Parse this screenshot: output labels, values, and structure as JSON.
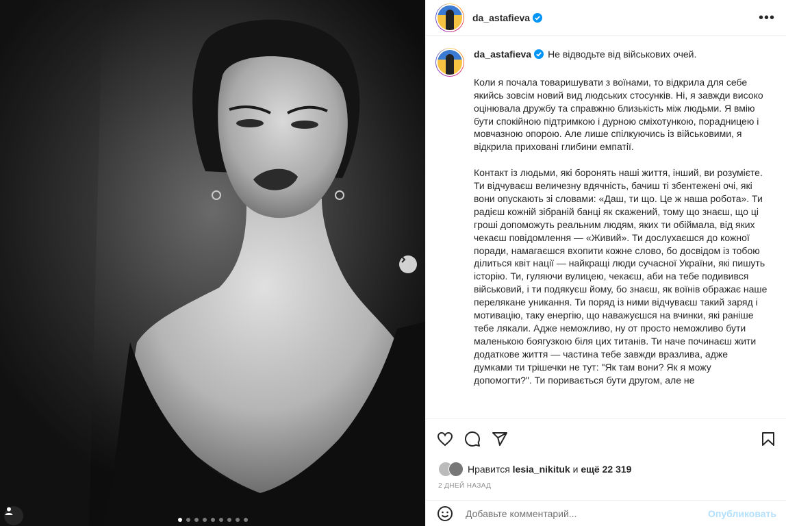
{
  "post": {
    "username": "da_astafieva",
    "verified": true,
    "more_label": "•••"
  },
  "caption": {
    "username": "da_astafieva",
    "first_line": "Не відводьте від військових очей.",
    "text": "Коли я почала товаришувати з воїнами, то відкрила для себе якийсь зовсім новий вид людських стосунків. Ні, я завжди високо оцінювала дружбу та справжню близькість між людьми. Я вмію бути спокійною підтримкою і дурною сміхотункою, порадницею і мовчазною опорою. Але лише спілкуючись із військовими, я відкрила приховані глибини емпатії.\n\nКонтакт із людьми, які боронять наші життя, інший, ви розумієте. Ти відчуваєш величезну вдячність, бачиш ті збентежені очі, які вони опускають зі словами: «Даш, ти що. Це ж наша робота». Ти радієш кожній зібраній банці як скажений, тому що знаєш, що ці гроші допоможуть реальним людям, яких ти обіймала, від яких чекаєш повідомлення — «Живий». Ти дослухаєшся до кожної поради, намагаєшся вхопити кожне слово, бо досвідом із тобою ділиться квіт нації — найкращі люди сучасної України, які пишуть історію. Ти, гуляючи вулицею, чекаєш, аби на тебе подивився військовий, і ти подякуєш йому, бо знаєш, як воїнів ображає наше перелякане уникання. Ти поряд із ними відчуваєш такий заряд і мотивацію, таку енергію, що наважуєшся на вчинки, які раніше тебе лякали. Адже неможливо, ну от просто неможливо бути маленькою боягузкою біля цих титанів. Ти наче починаєш жити додаткове життя — частина тебе завжди вразлива, адже думками ти трішечки не тут: \"Як там вони? Як я можу допомогти?\". Ти поривається бути другом, але не"
  },
  "likes": {
    "prefix": "Нравится",
    "user": "lesia_nikituk",
    "middle": "и",
    "rest": "ещё 22 319"
  },
  "date": "2 ДНЕЙ НАЗАД",
  "comment_box": {
    "placeholder": "Добавьте комментарий...",
    "publish": "Опубликовать"
  },
  "carousel": {
    "total": 9,
    "active_index": 0
  },
  "icons": [
    "heart-icon",
    "comment-icon",
    "share-icon",
    "bookmark-icon",
    "emoji-icon",
    "chevron-right-icon",
    "user-tag-icon",
    "verified-icon"
  ],
  "colors": {
    "verified": "#0095f6",
    "publish_disabled": "#b2dffc",
    "date": "#8e8e8e"
  }
}
